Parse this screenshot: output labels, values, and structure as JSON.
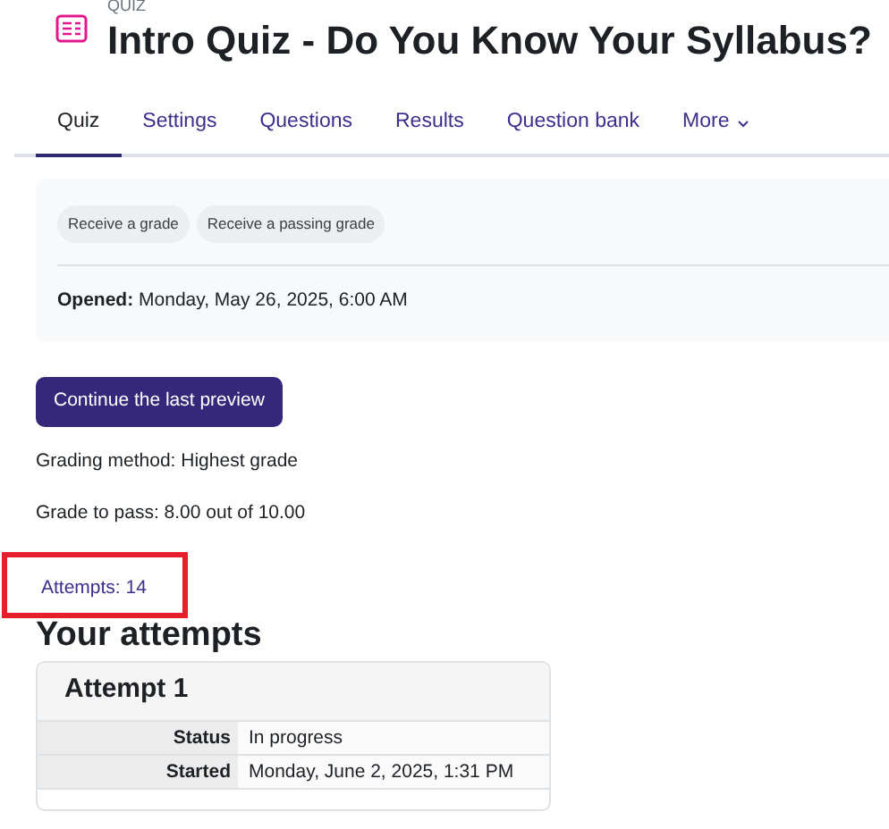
{
  "header": {
    "kicker": "QUIZ",
    "title": "Intro Quiz - Do You Know Your Syllabus?"
  },
  "tabs": [
    {
      "label": "Quiz",
      "selected": true
    },
    {
      "label": "Settings",
      "selected": false
    },
    {
      "label": "Questions",
      "selected": false
    },
    {
      "label": "Results",
      "selected": false
    },
    {
      "label": "Question bank",
      "selected": false
    },
    {
      "label": "More",
      "selected": false,
      "kind": "dropdown"
    }
  ],
  "completion": {
    "badges": [
      "Receive a grade",
      "Receive a passing grade"
    ],
    "opened": {
      "label": "Opened:",
      "value": "Monday, May 26, 2025, 6:00 AM"
    }
  },
  "primary_button": "Continue the last preview",
  "info": [
    "Grading method: Highest grade",
    "Grade to pass: 8.00 out of 10.00"
  ],
  "attempts_link": {
    "label": "Attempts: 14",
    "highlighted": true
  },
  "attempts_heading": "Your attempts",
  "attempts": [
    {
      "title": "Attempt 1",
      "rows": [
        {
          "label": "Status",
          "value": "In progress"
        },
        {
          "label": "Started",
          "value": "Monday, June 2, 2025, 1:31 PM"
        }
      ]
    }
  ]
}
